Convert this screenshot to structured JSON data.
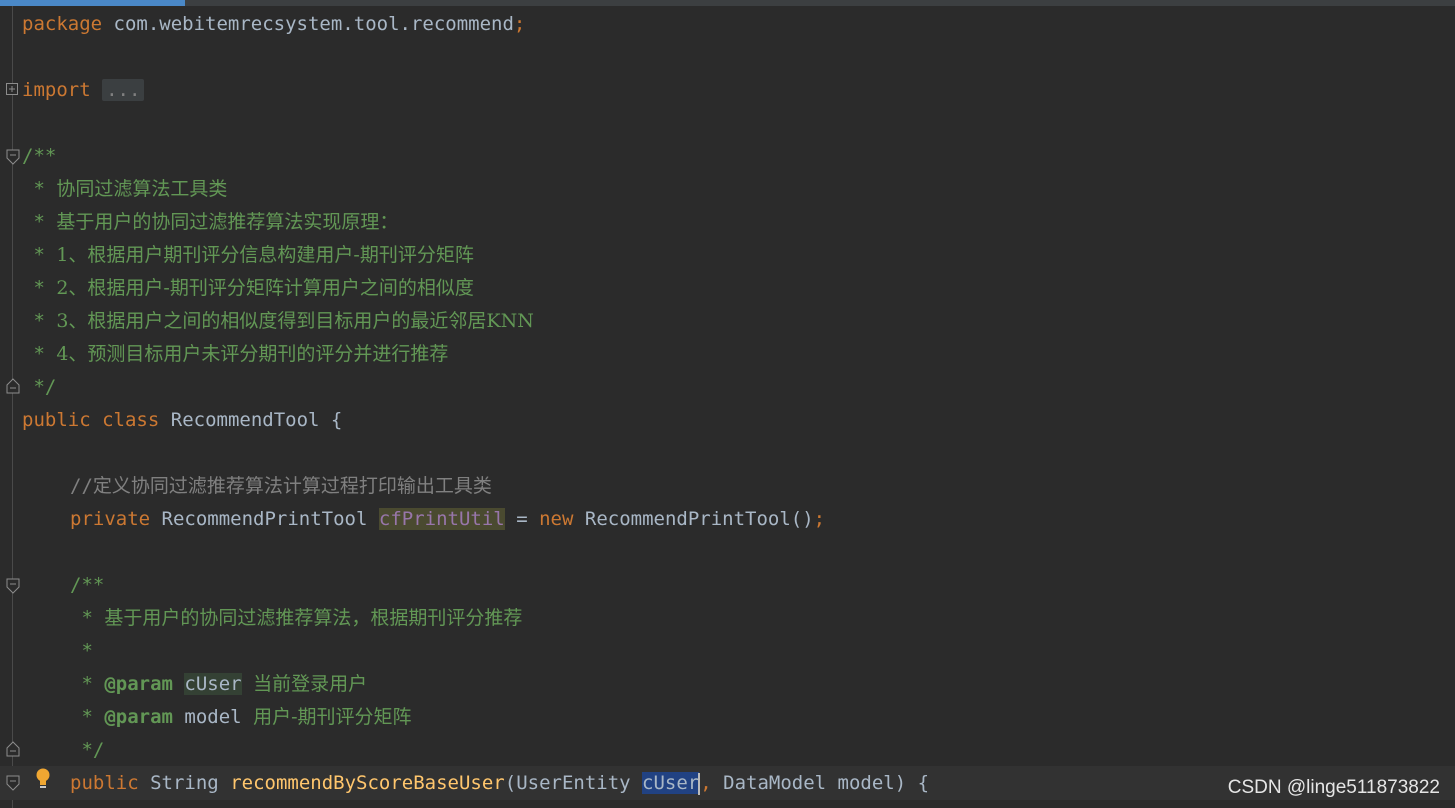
{
  "editor": {
    "lines": {
      "package_kw": "package",
      "package_name": "com.webitemrecsystem.tool.recommend",
      "semicolon": ";",
      "import_kw": "import",
      "import_folded": "...",
      "doc_open": "/**",
      "doc1_star": " * ",
      "doc1_text": "协同过滤算法工具类",
      "doc2_star": " * ",
      "doc2_text": "基于用户的协同过滤推荐算法实现原理：",
      "doc3_star": " * ",
      "doc3_text": "1、根据用户期刊评分信息构建用户-期刊评分矩阵",
      "doc4_star": " * ",
      "doc4_text": "2、根据用户-期刊评分矩阵计算用户之间的相似度",
      "doc5_star": " * ",
      "doc5_text": "3、根据用户之间的相似度得到目标用户的最近邻居KNN",
      "doc6_star": " * ",
      "doc6_text": "4、预测目标用户未评分期刊的评分并进行推荐",
      "doc_close": " */",
      "class_public": "public",
      "class_kw": "class",
      "class_name": "RecommendTool",
      "class_brace": "{",
      "comment_slashes": "//",
      "comment_text": "定义协同过滤推荐算法计算过程打印输出工具类",
      "field_private": "private",
      "field_type": "RecommendPrintTool",
      "field_name": "cfPrintUtil",
      "field_eq": "=",
      "field_new": "new",
      "field_ctor": "RecommendPrintTool()",
      "mdoc_open": "/**",
      "mdoc1_star": " * ",
      "mdoc1_text": "基于用户的协同过滤推荐算法，根据期刊评分推荐",
      "mdoc2_star": " *",
      "mdoc3_star": " * ",
      "mdoc3_tag": "@param",
      "mdoc3_name": "cUser",
      "mdoc3_desc": "当前登录用户",
      "mdoc4_star": " * ",
      "mdoc4_tag": "@param",
      "mdoc4_name": "model",
      "mdoc4_desc": "用户-期刊评分矩阵",
      "mdoc_close": " */",
      "method_public": "public",
      "method_type": "String",
      "method_name": "recommendByScoreBaseUser",
      "method_paren_open": "(",
      "method_param1_type": "UserEntity",
      "method_param1_name": "cUser",
      "method_comma": ",",
      "method_param2_type": "DataModel",
      "method_param2_name": "model",
      "method_paren_close": ")",
      "method_brace": "{"
    }
  },
  "watermark": {
    "text": "CSDN @linge511873822"
  },
  "icons": {
    "fold_expand": "fold-expand-icon",
    "fold_collapse": "fold-collapse-icon",
    "fold_end": "fold-end-icon",
    "bulb": "lightbulb-icon"
  },
  "colors": {
    "background": "#2b2b2b",
    "keyword": "#cc7832",
    "text": "#a9b7c6",
    "doc_comment": "#629755",
    "line_comment": "#808080",
    "field": "#9876aa",
    "method": "#ffc66d",
    "bulb": "#f0a732"
  }
}
